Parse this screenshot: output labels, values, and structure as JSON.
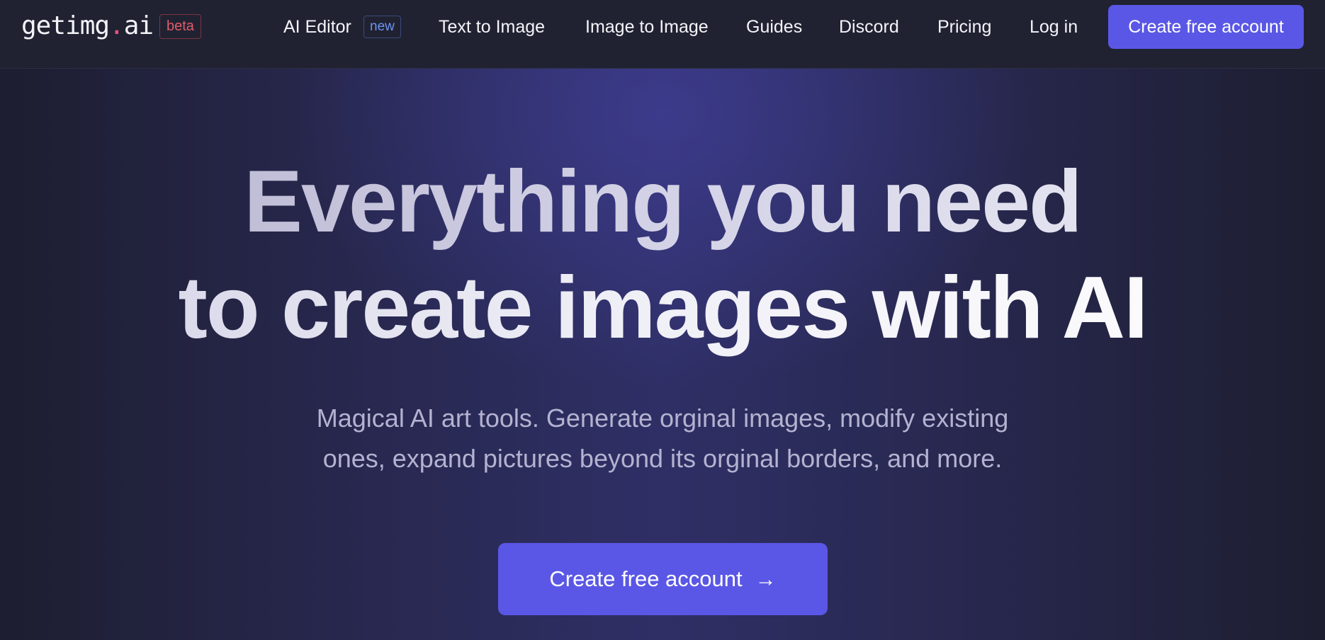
{
  "header": {
    "logo": {
      "name": "getimg",
      "dot": ".",
      "tld": "ai"
    },
    "beta_badge": "beta",
    "nav": [
      {
        "label": "AI Editor"
      },
      {
        "label": "Text to Image"
      },
      {
        "label": "Image to Image"
      },
      {
        "label": "Guides"
      },
      {
        "label": "Discord"
      },
      {
        "label": "Pricing"
      },
      {
        "label": "Log in"
      }
    ],
    "new_badge": "new",
    "cta_label": "Create free account"
  },
  "hero": {
    "headline_line1": "Everything you need",
    "headline_line2": "to create images with AI",
    "subtitle_line1": "Magical AI art tools. Generate orginal images, modify existing",
    "subtitle_line2": "ones, expand pictures beyond its orginal borders, and more.",
    "cta_label": "Create free account",
    "cta_icon": "arrow-right-icon"
  },
  "colors": {
    "accent": "#5a57e6",
    "header_bg": "#202232",
    "beta_badge": "#e25b68",
    "new_badge": "#6d94f2",
    "logo_dot": "#e8527a"
  }
}
